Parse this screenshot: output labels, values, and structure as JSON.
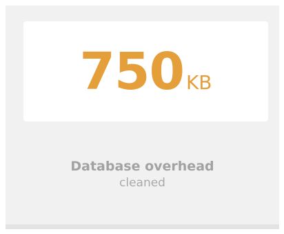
{
  "stat": {
    "value": "750",
    "unit": "KB",
    "title": "Database overhead",
    "subtitle": "cleaned"
  },
  "colors": {
    "accent": "#e49f3b",
    "card_background": "#f1f1f1",
    "value_box_background": "#ffffff",
    "caption_text": "#a2a2a2"
  }
}
